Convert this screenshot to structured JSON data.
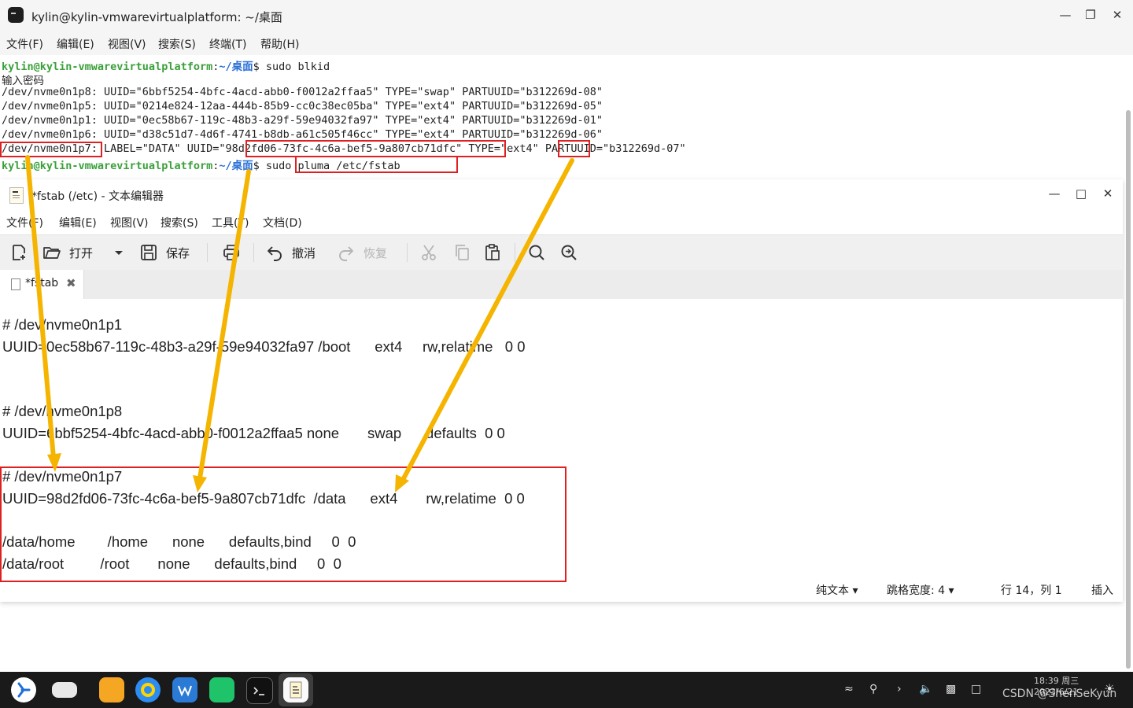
{
  "terminal": {
    "title": "kylin@kylin-vmwarevirtualplatform: ~/桌面",
    "menu": [
      "文件(F)",
      "编辑(E)",
      "视图(V)",
      "搜索(S)",
      "终端(T)",
      "帮助(H)"
    ],
    "prompt_user": "kylin@kylin-vmwarevirtualplatform",
    "prompt_path": "~/桌面",
    "cmd1": "sudo blkid",
    "password_prompt": "输入密码",
    "blkid_lines": [
      "/dev/nvme0n1p8: UUID=\"6bbf5254-4bfc-4acd-abb0-f0012a2ffaa5\" TYPE=\"swap\" PARTUUID=\"b312269d-08\"",
      "/dev/nvme0n1p5: UUID=\"0214e824-12aa-444b-85b9-cc0c38ec05ba\" TYPE=\"ext4\" PARTUUID=\"b312269d-05\"",
      "/dev/nvme0n1p1: UUID=\"0ec58b67-119c-48b3-a29f-59e94032fa97\" TYPE=\"ext4\" PARTUUID=\"b312269d-01\"",
      "/dev/nvme0n1p6: UUID=\"d38c51d7-4d6f-4741-b8db-a61c505f46cc\" TYPE=\"ext4\" PARTUUID=\"b312269d-06\"",
      "/dev/nvme0n1p7: LABEL=\"DATA\" UUID=\"98d2fd06-73fc-4c6a-bef5-9a807cb71dfc\" TYPE=\"ext4\" PARTUUID=\"b312269d-07\""
    ],
    "cmd2": "sudo pluma /etc/fstab"
  },
  "editor": {
    "title": "*fstab (/etc) - 文本编辑器",
    "menu": [
      "文件(F)",
      "编辑(E)",
      "视图(V)",
      "搜索(S)",
      "工具(T)",
      "文档(D)"
    ],
    "toolbar": {
      "open": "打开",
      "save": "保存",
      "undo": "撤消",
      "redo": "恢复"
    },
    "tab_label": "*fstab",
    "lines": [
      "# /dev/nvme0n1p1",
      "UUID=0ec58b67-119c-48b3-a29f-59e94032fa97 /boot      ext4     rw,relatime   0 0",
      "# /dev/nvme0n1p8",
      "UUID=6bbf5254-4bfc-4acd-abb0-f0012a2ffaa5 none       swap      defaults  0 0",
      "# /dev/nvme0n1p7",
      "UUID=98d2fd06-73fc-4c6a-bef5-9a807cb71dfc  /data      ext4       rw,relatime  0 0",
      "/data/home        /home      none      defaults,bind     0  0",
      "/data/root         /root       none      defaults,bind     0  0"
    ],
    "status": {
      "syntax": "纯文本",
      "tab_width": "跳格宽度: 4",
      "position": "行 14，列 1",
      "mode": "插入"
    }
  },
  "taskbar": {
    "clock_time": "18:39 周三",
    "clock_date": "2023/6/21",
    "watermark": "CSDN @ShenSeKyun"
  },
  "colors": {
    "highlight_box": "#e02020",
    "arrow": "#f5b400",
    "prompt_user": "#3aa03a",
    "prompt_path": "#2a6fd6"
  }
}
